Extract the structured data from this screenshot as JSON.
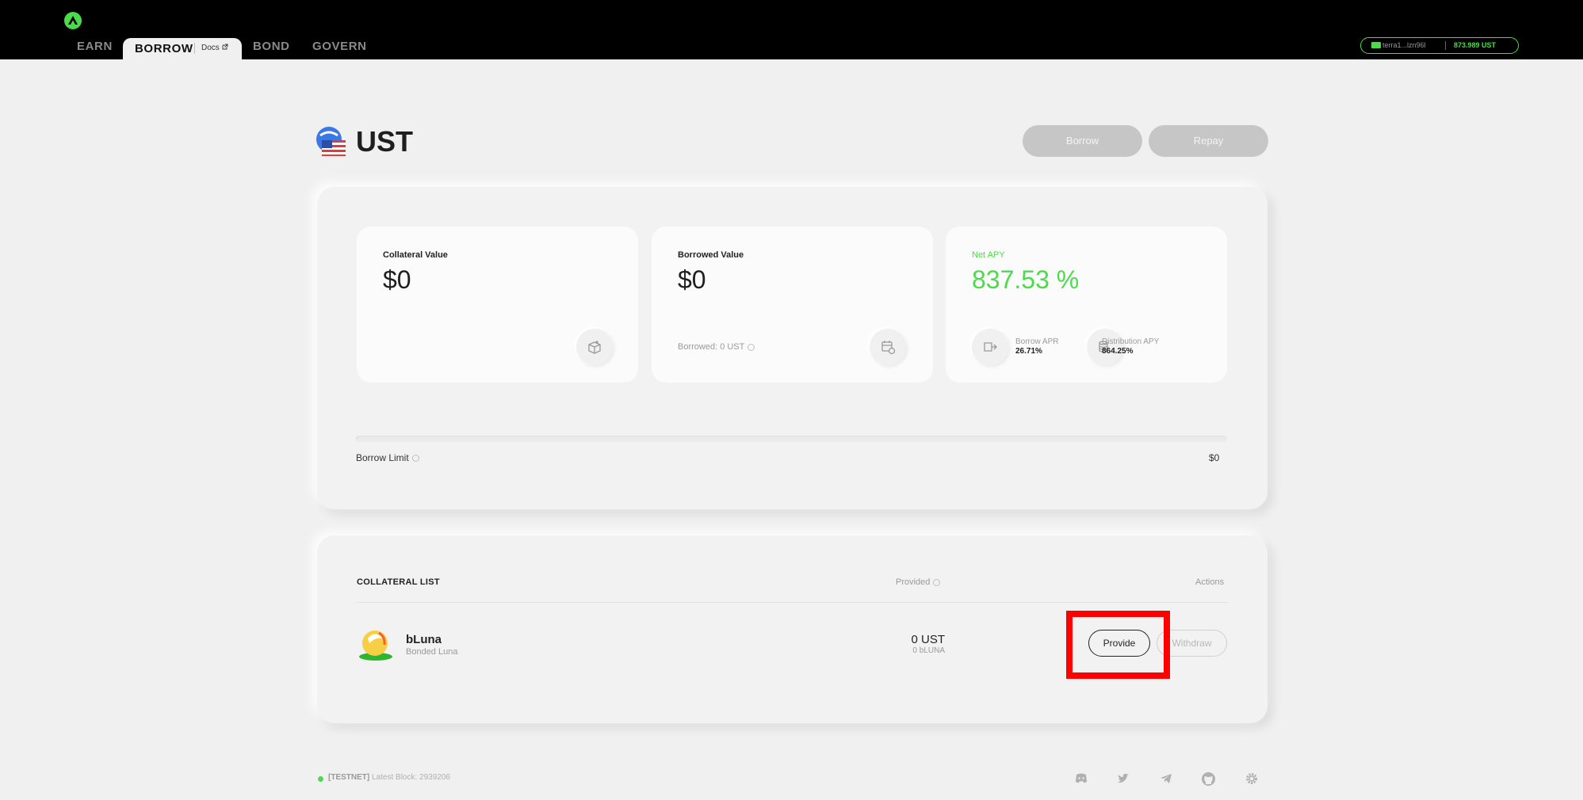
{
  "nav": {
    "tabs": [
      "EARN",
      "BORROW",
      "BOND",
      "GOVERN"
    ],
    "active": "BORROW",
    "docs_label": "Docs"
  },
  "wallet": {
    "address": "terra1...lzn96l",
    "balance": "873.989 UST"
  },
  "header": {
    "title": "UST",
    "borrow_label": "Borrow",
    "repay_label": "Repay"
  },
  "cards": {
    "collateral": {
      "title": "Collateral Value",
      "value": "$0"
    },
    "borrowed": {
      "title": "Borrowed Value",
      "value": "$0",
      "sub": "Borrowed: 0 UST"
    },
    "apy": {
      "title": "Net APY",
      "value": "837.53 %",
      "borrow_apr_label": "Borrow APR",
      "borrow_apr_value": "26.71%",
      "distribution_apy_label": "Distribution APY",
      "distribution_apy_value": "864.25%"
    }
  },
  "borrow_limit": {
    "label": "Borrow Limit",
    "value": "$0",
    "used_fraction": 0
  },
  "collateral_list": {
    "title": "COLLATERAL LIST",
    "col_provided": "Provided",
    "col_actions": "Actions",
    "rows": [
      {
        "name": "bLuna",
        "full_name": "Bonded Luna",
        "provided_ust": "0 UST",
        "provided_token": "0 bLUNA",
        "provide_label": "Provide",
        "withdraw_label": "Withdraw"
      }
    ]
  },
  "footer": {
    "network": "[TESTNET]",
    "block_text": "Latest Block: 2939206"
  },
  "colors": {
    "accent": "#4bdb4b",
    "topbar": "#000000",
    "background": "#f0f0f0",
    "highlight": "#ff0000"
  },
  "icons": [
    "anchor-logo-icon",
    "external-link-icon",
    "wallet-icon",
    "ust-flag-icon",
    "collateral-box-icon",
    "borrowed-calendar-icon",
    "borrow-apr-icon",
    "distribution-coins-icon",
    "info-icon",
    "bluna-icon",
    "discord-icon",
    "twitter-icon",
    "telegram-icon",
    "github-icon",
    "settings-gear-icon"
  ]
}
